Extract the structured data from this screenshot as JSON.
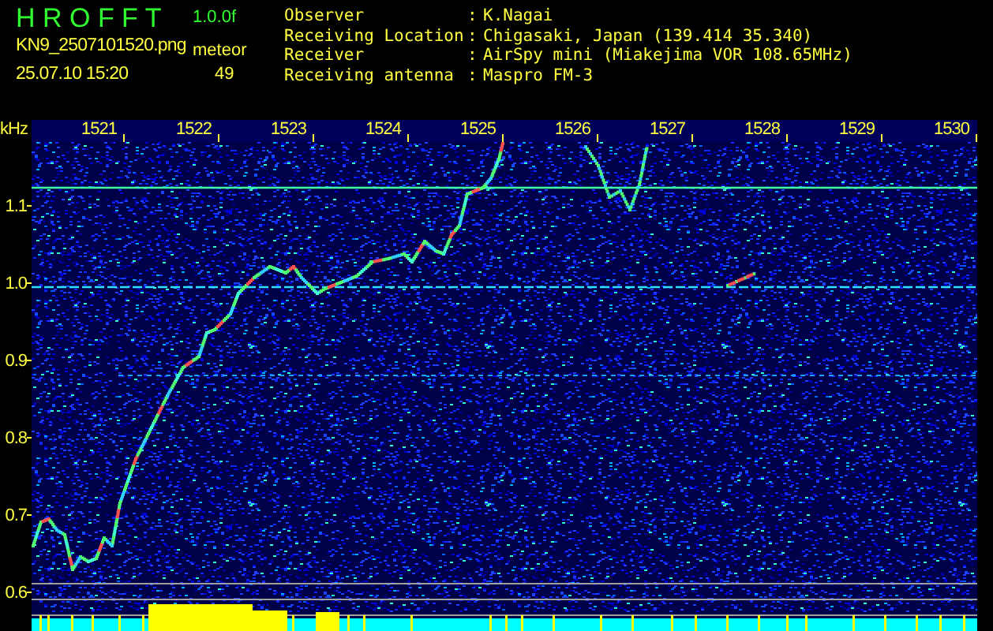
{
  "app": {
    "name": "H R O F F T",
    "version": "1.0.0f",
    "filename": "KN9_2507101520.png",
    "timestamp": "25.07.10 15:20",
    "count_label": "meteor",
    "count": "49"
  },
  "info": [
    {
      "label": "Observer",
      "separator": ":",
      "value": "K.Nagai"
    },
    {
      "label": "Receiving Location",
      "separator": ":",
      "value": "Chigasaki, Japan (139.414 35.340)"
    },
    {
      "label": "Receiver",
      "separator": ":",
      "value": "AirSpy mini (Miakejima VOR 108.65MHz)"
    },
    {
      "label": "Receiving antenna",
      "separator": ":",
      "value": "Maspro FM-3"
    }
  ],
  "spectrogram": {
    "unit": "kHz",
    "x_labels": [
      "1521",
      "1522",
      "1523",
      "1524",
      "1525",
      "1526",
      "1527",
      "1528",
      "1529",
      "1530"
    ],
    "y_labels": [
      "1.1",
      "1.0",
      "0.9",
      "0.8",
      "0.7",
      "0.6"
    ]
  }
}
